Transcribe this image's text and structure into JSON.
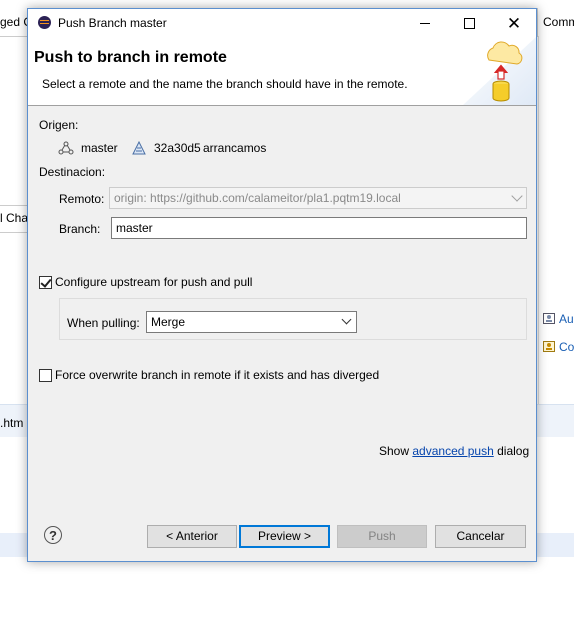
{
  "background": {
    "tab_left": "ged C",
    "tab_right": "Comm",
    "left_tab2": "l Cha",
    "right_items": [
      {
        "label": "Au",
        "icon": "author-icon"
      },
      {
        "label": "Co",
        "icon": "committer-icon"
      }
    ],
    "html_text": ".htm"
  },
  "window": {
    "title": "Push Branch master",
    "icon": "eclipse-icon"
  },
  "banner": {
    "title": "Push to branch in remote",
    "description": "Select a remote and the name the branch should have in the remote.",
    "art": "cloud-push-database-icon"
  },
  "source": {
    "label": "Origen:",
    "branch": "master",
    "commit_id": "32a30d5",
    "commit_message": "arrancamos"
  },
  "destination": {
    "label": "Destinacion:",
    "remote_label": "Remoto:",
    "remote_value": "origin: https://github.com/calameitor/pla1.pqtm19.local",
    "branch_label": "Branch:",
    "branch_value": "master"
  },
  "upstream": {
    "label": "Configure upstream for push and pull",
    "checked": true,
    "when_pulling_label": "When pulling:",
    "when_pulling_value": "Merge"
  },
  "force": {
    "label": "Force overwrite branch in remote if it exists and has diverged",
    "checked": false
  },
  "advanced": {
    "prefix": "Show",
    "link": "advanced push",
    "suffix": "dialog"
  },
  "buttons": {
    "help": "?",
    "back": "< Anterior",
    "preview": "Preview >",
    "push": "Push",
    "cancel": "Cancelar"
  },
  "colors": {
    "accent": "#0078d7",
    "link": "#0645ad",
    "dialog_bg": "#f0f0f0"
  }
}
